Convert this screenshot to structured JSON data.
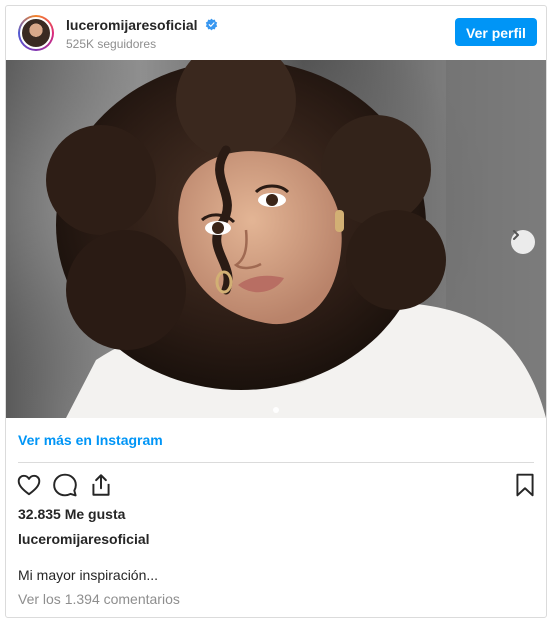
{
  "header": {
    "username": "luceromijaresoficial",
    "followers": "525K seguidores",
    "profile_button": "Ver perfil"
  },
  "post": {
    "more_link": "Ver más en Instagram",
    "likes": "32.835 Me gusta",
    "caption_user": "luceromijaresoficial",
    "caption": "Mi mayor inspiración...",
    "comments_link": "Ver los 1.394 comentarios"
  },
  "icons": {
    "verified": "verified-badge-icon",
    "next": "chevron-right-icon",
    "like": "heart-icon",
    "comment": "comment-icon",
    "share": "share-icon",
    "save": "bookmark-icon"
  },
  "colors": {
    "accent": "#0095f6",
    "text": "#262626",
    "muted": "#8e8e8e",
    "border": "#dbdbdb"
  }
}
